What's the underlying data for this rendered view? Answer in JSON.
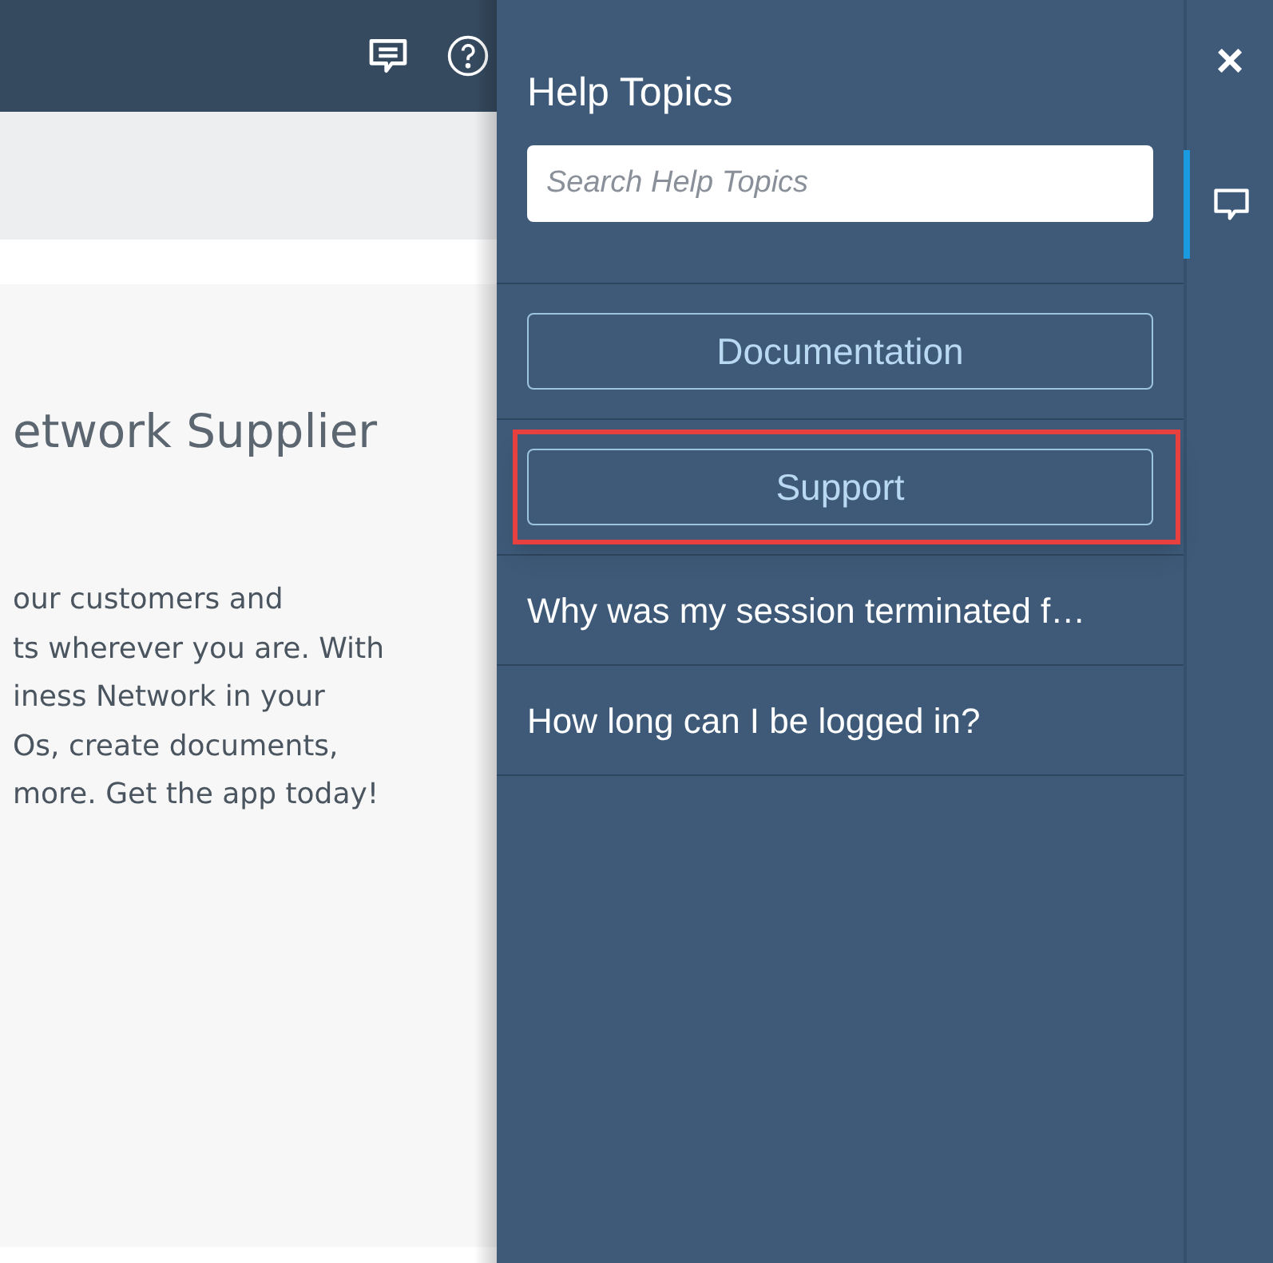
{
  "background_page": {
    "heading": "etwork Supplier",
    "paragraph_lines": [
      "our customers and",
      "ts wherever you are. With",
      "iness Network in your",
      "Os, create documents,",
      "more. Get the app today!"
    ]
  },
  "help_panel": {
    "title": "Help Topics",
    "search": {
      "placeholder": "Search Help Topics"
    },
    "buttons": [
      {
        "label": "Documentation",
        "highlighted": false
      },
      {
        "label": "Support",
        "highlighted": true
      }
    ],
    "topics": [
      "Why was my session terminated f…",
      "How long can I be logged in?"
    ]
  },
  "side_rail": {
    "close_label": "×",
    "tabs": [
      {
        "kind": "chat",
        "selected": true
      }
    ]
  }
}
